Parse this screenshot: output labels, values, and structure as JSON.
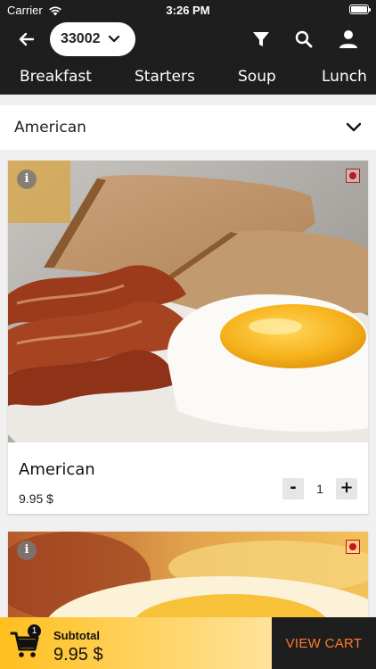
{
  "status_bar": {
    "carrier": "Carrier",
    "time": "3:26 PM",
    "wifi_icon": "wifi-icon",
    "battery_icon": "battery-icon"
  },
  "header": {
    "zip_code": "33002",
    "back_icon": "arrow-left-icon",
    "dropdown_icon": "chevron-down-icon",
    "filter_icon": "filter-icon",
    "search_icon": "search-icon",
    "profile_icon": "user-icon"
  },
  "tabs": [
    "Breakfast",
    "Starters",
    "Soup",
    "Lunch"
  ],
  "category_dropdown": {
    "selected": "American",
    "icon": "chevron-down-icon"
  },
  "menu_items": [
    {
      "name": "American",
      "price": "9.95 $",
      "quantity": "1",
      "minus_label": "-",
      "plus_label": "+",
      "info_label": "i",
      "indicator": "non-veg-indicator"
    },
    {
      "info_label": "i",
      "indicator": "non-veg-indicator"
    }
  ],
  "cart_bar": {
    "badge_count": "1",
    "subtotal_label": "Subtotal",
    "subtotal_value": "9.95 $",
    "view_cart_label": "VIEW CART"
  },
  "colors": {
    "header_bg": "#1e1e1e",
    "cart_gradient_start": "#ffbf1f",
    "cart_gradient_end": "#ffe39a",
    "view_cart_text": "#ff7a2a",
    "indicator_red": "#c4161c"
  }
}
